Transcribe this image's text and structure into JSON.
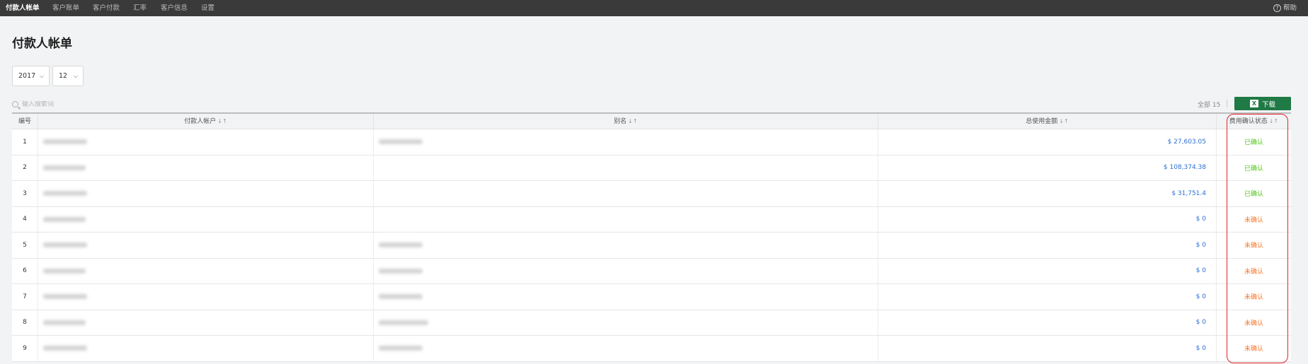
{
  "nav": {
    "items": [
      {
        "label": "付款人帐单",
        "active": true
      },
      {
        "label": "客户账单",
        "active": false
      },
      {
        "label": "客户付款",
        "active": false
      },
      {
        "label": "汇率",
        "active": false
      },
      {
        "label": "客户信息",
        "active": false
      },
      {
        "label": "设置",
        "active": false
      }
    ],
    "help_label": "帮助",
    "help_icon": "question-circle-icon"
  },
  "page": {
    "title": "付款人帐单"
  },
  "filters": {
    "year": "2017",
    "month": "12"
  },
  "search": {
    "placeholder": "输入搜索词"
  },
  "toolbar": {
    "total_label": "全部 15",
    "download_label": "下载",
    "download_icon": "excel-icon",
    "download_color": "#1f7a45"
  },
  "table": {
    "columns": {
      "no": "编号",
      "payer": "付款人帐户",
      "alias": "别名",
      "amount": "总使用金额",
      "status": "费用确认状态"
    },
    "rows": [
      {
        "no": "1",
        "amount": "$ 27,603.05",
        "status": "已确认",
        "confirmed": true,
        "has_alias": true
      },
      {
        "no": "2",
        "amount": "$ 108,374.38",
        "status": "已确认",
        "confirmed": true,
        "has_alias": false
      },
      {
        "no": "3",
        "amount": "$ 31,751.4",
        "status": "已确认",
        "confirmed": true,
        "has_alias": false
      },
      {
        "no": "4",
        "amount": "$ 0",
        "status": "未确认",
        "confirmed": false,
        "has_alias": false
      },
      {
        "no": "5",
        "amount": "$ 0",
        "status": "未确认",
        "confirmed": false,
        "has_alias": true
      },
      {
        "no": "6",
        "amount": "$ 0",
        "status": "未确认",
        "confirmed": false,
        "has_alias": true
      },
      {
        "no": "7",
        "amount": "$ 0",
        "status": "未确认",
        "confirmed": false,
        "has_alias": true
      },
      {
        "no": "8",
        "amount": "$ 0",
        "status": "未确认",
        "confirmed": false,
        "has_alias": true
      },
      {
        "no": "9",
        "amount": "$ 0",
        "status": "未确认",
        "confirmed": false,
        "has_alias": true
      }
    ]
  },
  "colors": {
    "confirmed": "#52c41a",
    "unconfirmed": "#f5762a",
    "amount": "#2d6fd6",
    "highlight": "#e0242b"
  }
}
